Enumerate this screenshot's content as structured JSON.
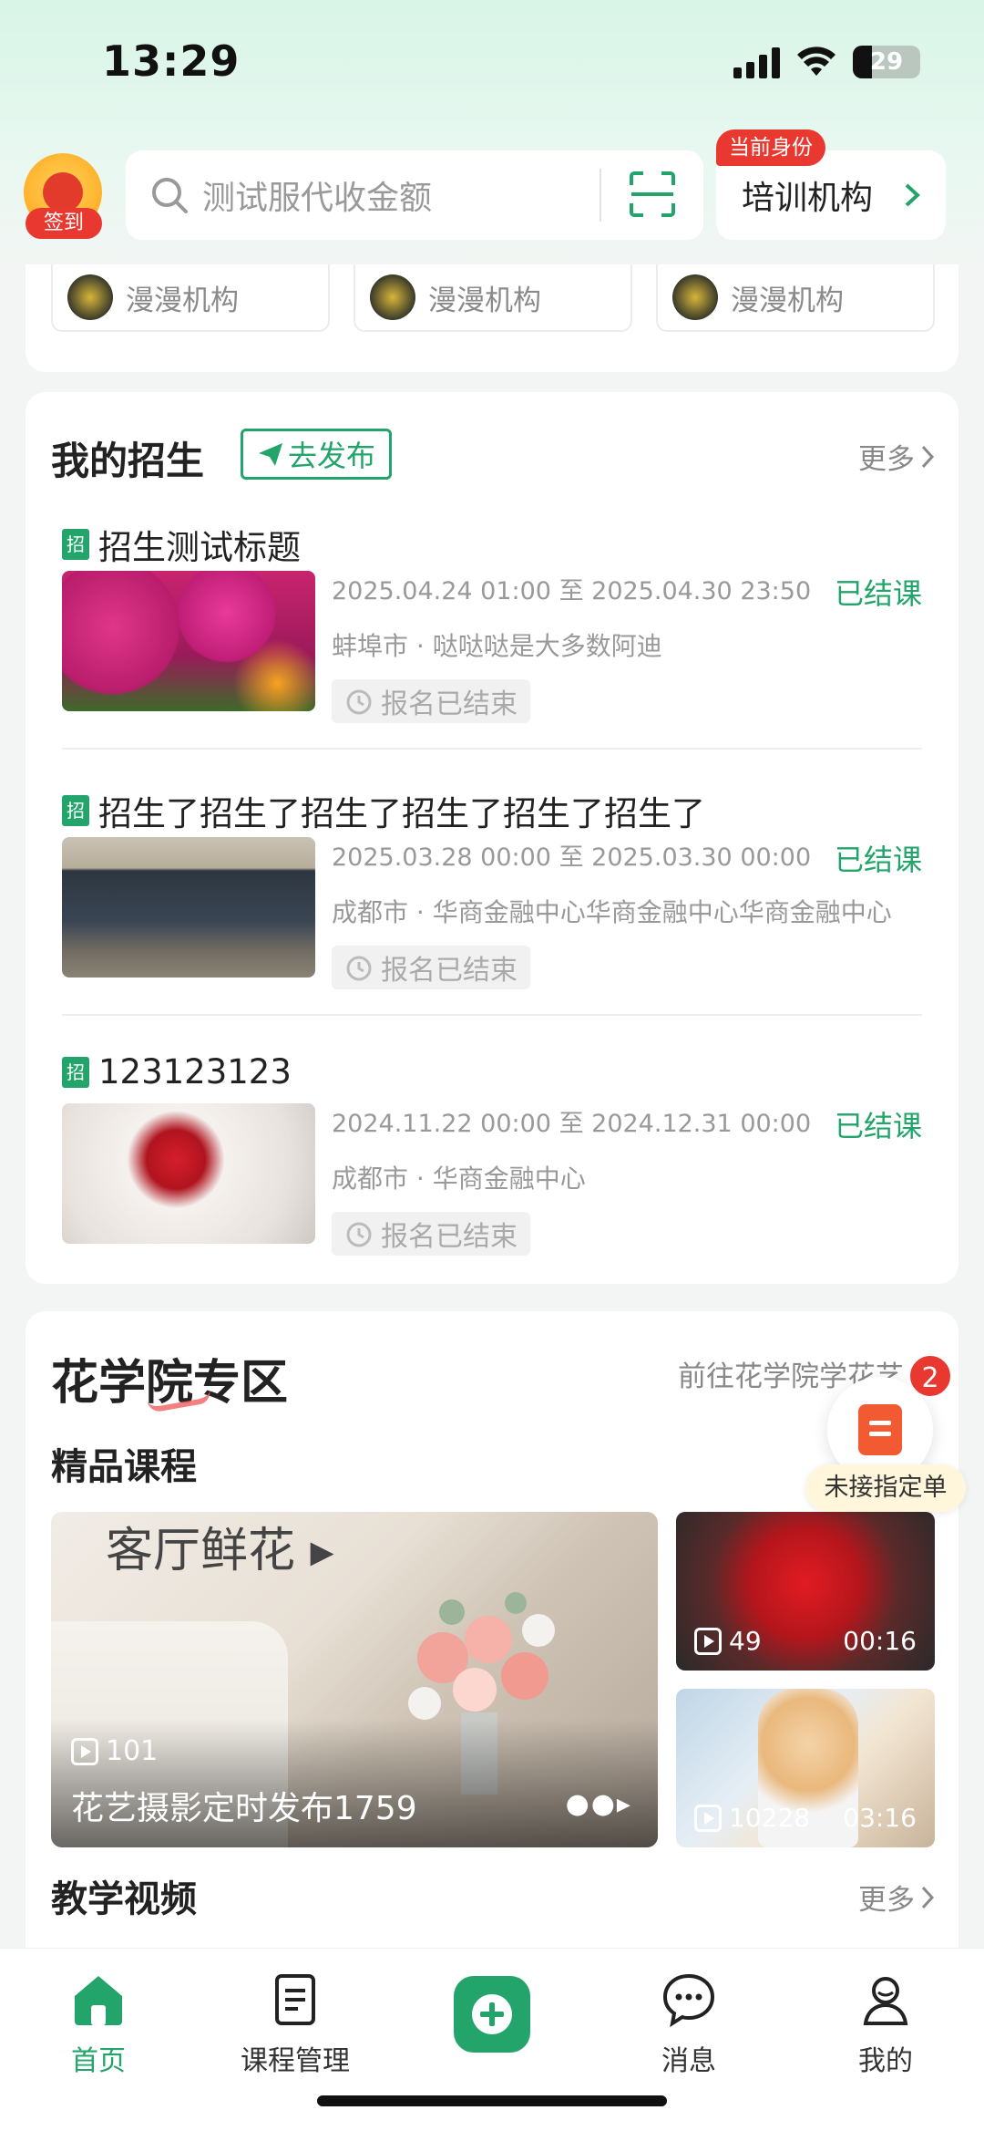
{
  "status_bar": {
    "time": "13:29",
    "battery": "29"
  },
  "header": {
    "signin_label": "签到",
    "search_placeholder": "测试服代收金额",
    "identity_badge": "当前身份",
    "identity_value": "培训机构"
  },
  "orgs": [
    {
      "name": "漫漫机构"
    },
    {
      "name": "漫漫机构"
    },
    {
      "name": "漫漫机构"
    }
  ],
  "recruit": {
    "title": "我的招生",
    "publish_label": "去发布",
    "more_label": "更多",
    "tag": "招",
    "items": [
      {
        "title": "招生测试标题",
        "date": "2025.04.24 01:00 至 2025.04.30 23:50",
        "status": "已结课",
        "address": "蚌埠市 · 哒哒哒是大多数阿迪",
        "enroll": "报名已结束"
      },
      {
        "title": "招生了招生了招生了招生了招生了招生了",
        "date": "2025.03.28 00:00 至 2025.03.30 00:00",
        "status": "已结课",
        "address": "成都市 · 华商金融中心华商金融中心华商金融中心",
        "enroll": "报名已结束"
      },
      {
        "title": "123123123",
        "date": "2024.11.22 00:00 至 2024.12.31 00:00",
        "status": "已结课",
        "address": "成都市 · 华商金融中心",
        "enroll": "报名已结束"
      }
    ]
  },
  "academy": {
    "title": "花学院专区",
    "go_label": "前往花学院学花艺",
    "featured_title": "精品课程",
    "big_course": {
      "caption": "客厅鲜花",
      "views": "101",
      "name": "花艺摄影定时发布1759"
    },
    "small_courses": [
      {
        "views": "49",
        "duration": "00:16"
      },
      {
        "views": "10228",
        "duration": "03:16"
      }
    ],
    "videos_title": "教学视频",
    "videos_more": "更多"
  },
  "float_order": {
    "badge": "2",
    "label": "未接指定单"
  },
  "tabbar": {
    "home": "首页",
    "courses": "课程管理",
    "messages": "消息",
    "mine": "我的"
  },
  "colors": {
    "accent": "#22a46a",
    "red": "#e8382f"
  }
}
